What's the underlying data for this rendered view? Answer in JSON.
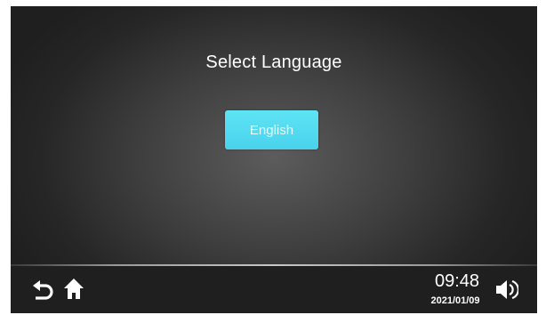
{
  "screen": {
    "title": "Select Language"
  },
  "languages": [
    {
      "label": "English",
      "selected": true
    }
  ],
  "status_bar": {
    "time": "09:48",
    "date": "2021/01/09"
  },
  "icons": {
    "back": "back-arrow-icon",
    "home": "home-icon",
    "volume": "speaker-volume-icon"
  },
  "colors": {
    "button_accent": "#4fdaf0",
    "text": "#ffffff",
    "background": "#2a2a2a"
  }
}
